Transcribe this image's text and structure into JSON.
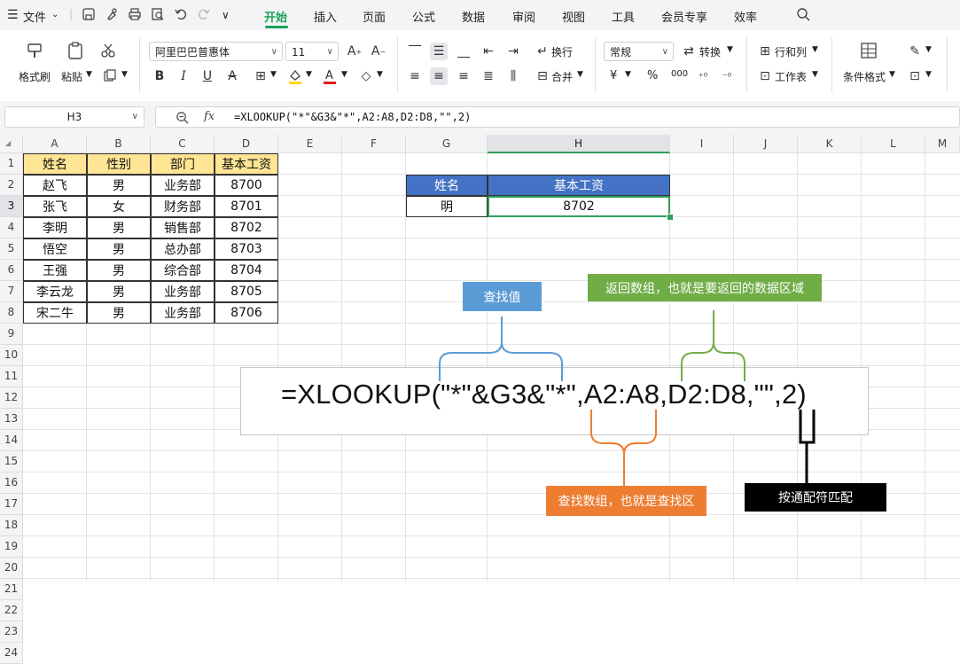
{
  "menubar": {
    "file_label": "文件",
    "tabs": [
      {
        "label": "开始",
        "active": true
      },
      {
        "label": "插入"
      },
      {
        "label": "页面"
      },
      {
        "label": "公式"
      },
      {
        "label": "数据"
      },
      {
        "label": "审阅"
      },
      {
        "label": "视图"
      },
      {
        "label": "工具"
      },
      {
        "label": "会员专享"
      },
      {
        "label": "效率"
      }
    ],
    "accent_color": "#1aa05a"
  },
  "ribbon": {
    "format_painter": "格式刷",
    "paste": "粘贴",
    "font_name": "阿里巴巴普惠体",
    "font_size": "11",
    "wrap": "换行",
    "merge": "合并",
    "number_format": "常规",
    "convert": "转换",
    "rows_cols": "行和列",
    "worksheet": "工作表",
    "cond_format": "条件格式",
    "currency": "¥",
    "percent": "%",
    "thousands": "000"
  },
  "formula_bar": {
    "name_box": "H3",
    "fx": "fx",
    "formula": "=XLOOKUP(\"*\"&G3&\"*\",A2:A8,D2:D8,\"\",2)"
  },
  "sheet": {
    "columns": [
      "A",
      "B",
      "C",
      "D",
      "E",
      "F",
      "G",
      "H",
      "I",
      "J",
      "K",
      "L",
      "M"
    ],
    "rows": [
      "1",
      "2",
      "3",
      "4",
      "5",
      "6",
      "7",
      "8",
      "9",
      "10",
      "11",
      "12",
      "13",
      "14",
      "15",
      "16",
      "17",
      "18",
      "19",
      "20",
      "21",
      "22",
      "23",
      "24"
    ],
    "selected_column": "H",
    "selected_row": "3",
    "table_headers": [
      "姓名",
      "性别",
      "部门",
      "基本工资"
    ],
    "table_rows": [
      [
        "赵飞",
        "男",
        "业务部",
        "8700"
      ],
      [
        "张飞",
        "女",
        "财务部",
        "8701"
      ],
      [
        "李明",
        "男",
        "销售部",
        "8702"
      ],
      [
        "悟空",
        "男",
        "总办部",
        "8703"
      ],
      [
        "王强",
        "男",
        "综合部",
        "8704"
      ],
      [
        "李云龙",
        "男",
        "业务部",
        "8705"
      ],
      [
        "宋二牛",
        "男",
        "业务部",
        "8706"
      ]
    ],
    "lookup_headers": [
      "姓名",
      "基本工资"
    ],
    "lookup_values": [
      "明",
      "8702"
    ]
  },
  "annotation": {
    "big_formula": "=XLOOKUP(\"*\"&G3&\"*\",A2:A8,D2:D8,\"\",2)",
    "lookup_value_label": "查找值",
    "return_array_label": "返回数组，也就是要返回的数据区域",
    "lookup_array_label": "查找数组，也就是查找区",
    "wildcard_label": "按通配符匹配",
    "colors": {
      "blue": "#5b9bd5",
      "green": "#70ad47",
      "orange": "#ed7d31",
      "black": "#000000"
    }
  }
}
